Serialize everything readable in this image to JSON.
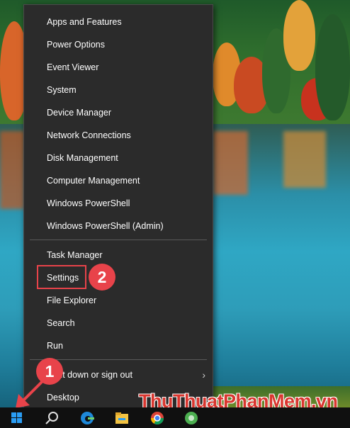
{
  "menu": {
    "items": [
      {
        "label": "Apps and Features"
      },
      {
        "label": "Power Options"
      },
      {
        "label": "Event Viewer"
      },
      {
        "label": "System"
      },
      {
        "label": "Device Manager"
      },
      {
        "label": "Network Connections"
      },
      {
        "label": "Disk Management"
      },
      {
        "label": "Computer Management"
      },
      {
        "label": "Windows PowerShell"
      },
      {
        "label": "Windows PowerShell (Admin)"
      },
      {
        "label": "Task Manager"
      },
      {
        "label": "Settings"
      },
      {
        "label": "File Explorer"
      },
      {
        "label": "Search"
      },
      {
        "label": "Run"
      },
      {
        "label": "Shut down or sign out"
      },
      {
        "label": "Desktop"
      }
    ],
    "submenu_chevron": "›"
  },
  "annotations": {
    "step1": "1",
    "step2": "2",
    "highlight_color": "#e8434a"
  },
  "watermark": "ThuThuatPhanMem.vn",
  "taskbar": {
    "icons": [
      "windows-start-icon",
      "search-icon",
      "edge-icon",
      "file-explorer-icon",
      "chrome-icon",
      "green-app-icon"
    ]
  }
}
